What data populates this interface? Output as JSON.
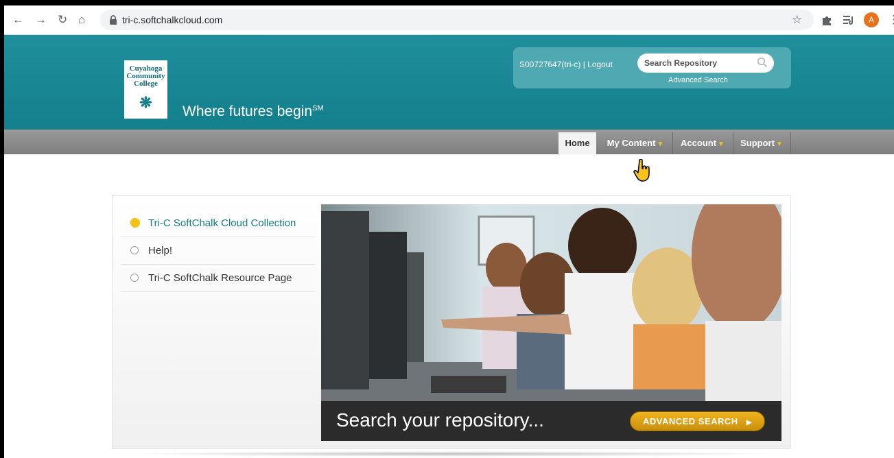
{
  "browser": {
    "url": "tri-c.softchalkcloud.com",
    "profile_initial": "A"
  },
  "header": {
    "logo_lines": [
      "Cuyahoga",
      "Community",
      "College"
    ],
    "tagline": "Where futures begin",
    "tagline_mark": "SM",
    "user_link": "S00727647(tri-c) | Logout",
    "search_placeholder": "Search Repository",
    "advanced_search_link": "Advanced Search"
  },
  "nav": {
    "items": [
      {
        "label": "Home",
        "active": true,
        "dropdown": false
      },
      {
        "label": "My Content",
        "active": false,
        "dropdown": true
      },
      {
        "label": "Account",
        "active": false,
        "dropdown": true
      },
      {
        "label": "Support",
        "active": false,
        "dropdown": true
      }
    ],
    "caret": "▼"
  },
  "sidebar": {
    "items": [
      {
        "label": "Tri-C SoftChalk Cloud Collection",
        "active": true
      },
      {
        "label": "Help!",
        "active": false
      },
      {
        "label": "Tri-C SoftChalk Resource Page",
        "active": false
      }
    ]
  },
  "hero": {
    "banner_text": "Search your repository...",
    "button_label": "ADVANCED SEARCH"
  },
  "colors": {
    "header_teal": "#13808c",
    "accent_yellow": "#f3c217",
    "link_teal": "#177d86"
  }
}
